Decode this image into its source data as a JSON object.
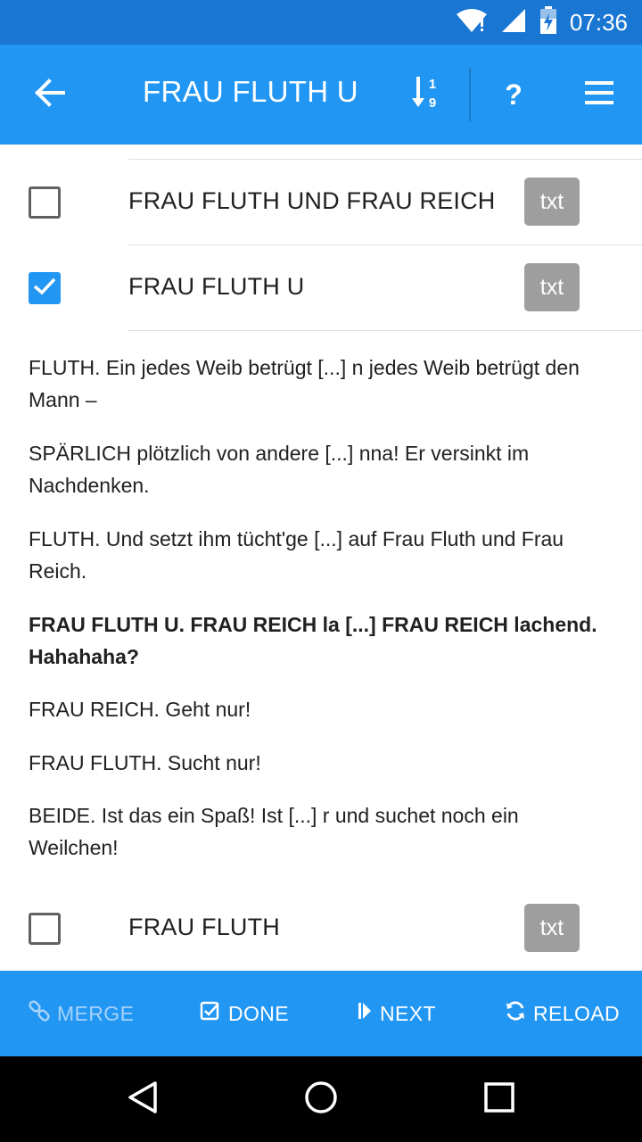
{
  "status_bar": {
    "time": "07:36",
    "icons": [
      "wifi-icon",
      "signal-icon",
      "battery-charging-icon"
    ]
  },
  "app_bar": {
    "title": "FRAU FLUTH U",
    "back_icon": "arrow-back-icon",
    "sort_icon": "sort-numeric-icon",
    "help_label": "?",
    "menu_icon": "menu-icon"
  },
  "list": {
    "items": [
      {
        "label": "FRAU FLUTH UND FRAU REICH",
        "checked": false,
        "action": "txt"
      },
      {
        "label": "FRAU FLUTH U",
        "checked": true,
        "action": "txt"
      },
      {
        "label": "FRAU FLUTH",
        "checked": false,
        "action": "txt"
      }
    ]
  },
  "content": {
    "paragraphs": [
      {
        "text": "FLUTH. Ein jedes Weib betrügt [...] n jedes Weib betrügt den Mann –",
        "bold": false
      },
      {
        "text": "SPÄRLICH plötzlich von andere [...] nna! Er versinkt im Nachdenken.",
        "bold": false
      },
      {
        "text": "FLUTH. Und setzt ihm tücht'ge [...] auf Frau Fluth und Frau Reich.",
        "bold": false
      },
      {
        "text": "FRAU FLUTH U. FRAU REICH la [...] FRAU REICH lachend. Hahahaha?",
        "bold": true
      },
      {
        "text": "FRAU REICH. Geht nur!",
        "bold": false
      },
      {
        "text": "FRAU FLUTH. Sucht nur!",
        "bold": false
      },
      {
        "text": "BEIDE. Ist das ein Spaß! Ist [...] r und suchet noch ein Weilchen!",
        "bold": false
      }
    ]
  },
  "bottom_bar": {
    "merge": "MERGE",
    "done": "DONE",
    "next": "NEXT",
    "reload": "RELOAD"
  },
  "colors": {
    "status_bar": "#1976D2",
    "primary": "#2196F3",
    "txt_button": "#9E9E9E",
    "disabled_text": "#A6D2FA"
  }
}
